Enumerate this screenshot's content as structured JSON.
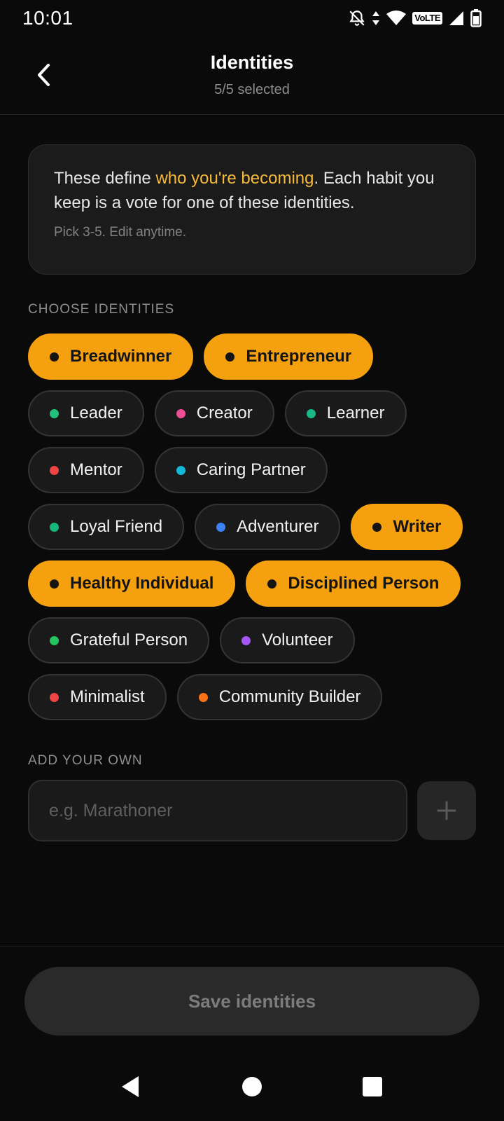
{
  "status_bar": {
    "time": "10:01",
    "network_label": "VoLTE"
  },
  "header": {
    "title": "Identities",
    "subtitle": "5/5 selected"
  },
  "info": {
    "text_before": "These define ",
    "highlight": "who you're becoming",
    "text_after": ". Each habit you keep is a vote for one of these identities.",
    "hint": "Pick 3-5. Edit anytime."
  },
  "choose_label": "CHOOSE IDENTITIES",
  "identities": [
    {
      "label": "Breadwinner",
      "selected": true,
      "color": "#141414"
    },
    {
      "label": "Entrepreneur",
      "selected": true,
      "color": "#141414"
    },
    {
      "label": "Leader",
      "selected": false,
      "color": "#22c07a"
    },
    {
      "label": "Creator",
      "selected": false,
      "color": "#ec4f95"
    },
    {
      "label": "Learner",
      "selected": false,
      "color": "#19b886"
    },
    {
      "label": "Mentor",
      "selected": false,
      "color": "#ef4444"
    },
    {
      "label": "Caring Partner",
      "selected": false,
      "color": "#12b8d6"
    },
    {
      "label": "Loyal Friend",
      "selected": false,
      "color": "#14b87a"
    },
    {
      "label": "Adventurer",
      "selected": false,
      "color": "#3b82f6"
    },
    {
      "label": "Writer",
      "selected": true,
      "color": "#141414"
    },
    {
      "label": "Healthy Individual",
      "selected": true,
      "color": "#141414"
    },
    {
      "label": "Disciplined Person",
      "selected": true,
      "color": "#141414"
    },
    {
      "label": "Grateful Person",
      "selected": false,
      "color": "#22c55e"
    },
    {
      "label": "Volunteer",
      "selected": false,
      "color": "#a855f7"
    },
    {
      "label": "Minimalist",
      "selected": false,
      "color": "#ef4444"
    },
    {
      "label": "Community Builder",
      "selected": false,
      "color": "#f97316"
    }
  ],
  "add_label": "ADD YOUR OWN",
  "add_input": {
    "placeholder": "e.g. Marathoner",
    "value": ""
  },
  "save_label": "Save identities"
}
